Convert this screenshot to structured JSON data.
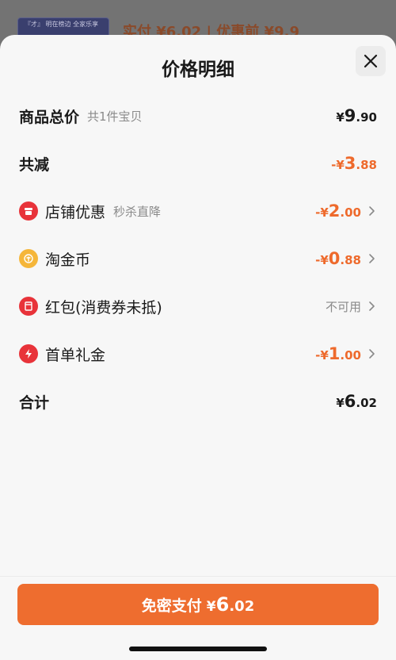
{
  "background": {
    "thumb_text": "『才』 明在榜边 全家乐享",
    "price_text": "实付 ¥6.02 | 优惠前 ¥9.9"
  },
  "sheet": {
    "title": "价格明细",
    "close_icon": "close-icon"
  },
  "rows": {
    "total": {
      "label": "商品总价",
      "sub": "共1件宝贝",
      "currency": "¥",
      "int": "9",
      "dec": ".90"
    },
    "reduce": {
      "label": "共减",
      "currency": "-¥",
      "int": "3",
      "dec": ".88"
    },
    "store": {
      "label": "店铺优惠",
      "sub": "秒杀直降",
      "currency": "-¥",
      "int": "2",
      "dec": ".00",
      "icon": "store-icon",
      "icon_color": "#e8333a"
    },
    "coin": {
      "label": "淘金币",
      "currency": "-¥",
      "int": "0",
      "dec": ".88",
      "icon": "coin-icon",
      "icon_color": "#f5b63a"
    },
    "redpacket": {
      "label": "红包(消费券未抵)",
      "status": "不可用",
      "icon": "red-packet-icon",
      "icon_color": "#e8333a"
    },
    "firstorder": {
      "label": "首单礼金",
      "currency": "-¥",
      "int": "1",
      "dec": ".00",
      "icon": "lightning-icon",
      "icon_color": "#e8333a"
    },
    "sum": {
      "label": "合计",
      "currency": "¥",
      "int": "6",
      "dec": ".02"
    }
  },
  "pay_button": {
    "label": "免密支付",
    "currency": "¥",
    "int": "6",
    "dec": ".02",
    "color": "#ee6d2f"
  },
  "colors": {
    "accent_orange": "#ee6a2c",
    "text_dark": "#1a1a1a",
    "text_gray": "#8a8a8a"
  }
}
